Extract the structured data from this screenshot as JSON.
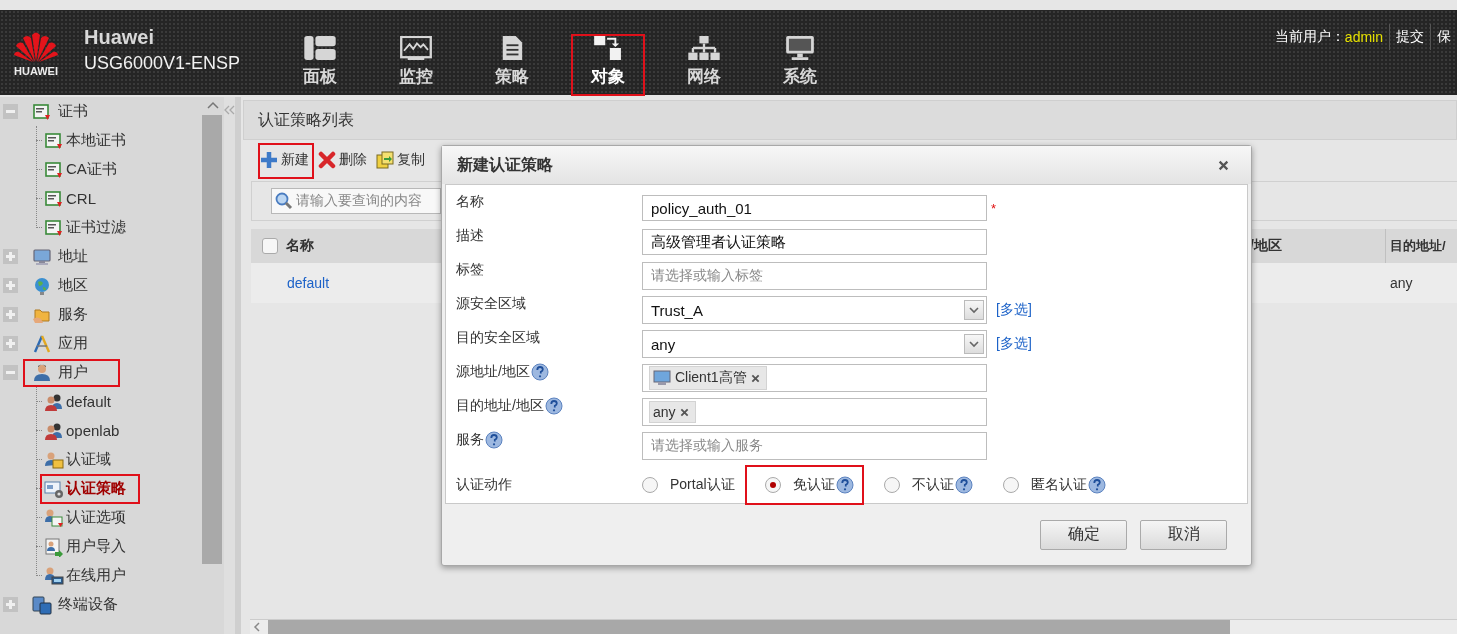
{
  "header": {
    "logo_text": "HUAWEI",
    "title": "Huawei",
    "model": "USG6000V1-ENSP",
    "nav": [
      {
        "label": "面板",
        "selected": false,
        "highlighted": false
      },
      {
        "label": "监控",
        "selected": false,
        "highlighted": false
      },
      {
        "label": "策略",
        "selected": false,
        "highlighted": false
      },
      {
        "label": "对象",
        "selected": true,
        "highlighted": true
      },
      {
        "label": "网络",
        "selected": false,
        "highlighted": false
      },
      {
        "label": "系统",
        "selected": false,
        "highlighted": false
      }
    ],
    "user_label": "当前用户：",
    "user": "admin",
    "actions": [
      {
        "label": "提交"
      },
      {
        "label": "保"
      }
    ]
  },
  "sidebar": {
    "tree": [
      {
        "label": "证书",
        "expanded": true,
        "selected": false,
        "highlighted": false,
        "children": [
          {
            "label": "本地证书",
            "selected": false,
            "highlighted": false
          },
          {
            "label": "CA证书",
            "selected": false,
            "highlighted": false
          },
          {
            "label": "CRL",
            "selected": false,
            "highlighted": false
          },
          {
            "label": "证书过滤",
            "selected": false,
            "highlighted": false
          }
        ]
      },
      {
        "label": "地址",
        "expanded": false,
        "selected": false,
        "highlighted": false
      },
      {
        "label": "地区",
        "expanded": false,
        "selected": false,
        "highlighted": false
      },
      {
        "label": "服务",
        "expanded": false,
        "selected": false,
        "highlighted": false
      },
      {
        "label": "应用",
        "expanded": false,
        "selected": false,
        "highlighted": false
      },
      {
        "label": "用户",
        "expanded": true,
        "selected": false,
        "highlighted": true,
        "children": [
          {
            "label": "default",
            "selected": false,
            "highlighted": false
          },
          {
            "label": "openlab",
            "selected": false,
            "highlighted": false
          },
          {
            "label": "认证域",
            "selected": false,
            "highlighted": false
          },
          {
            "label": "认证策略",
            "selected": true,
            "highlighted": true
          },
          {
            "label": "认证选项",
            "selected": false,
            "highlighted": false
          },
          {
            "label": "用户导入",
            "selected": false,
            "highlighted": false
          },
          {
            "label": "在线用户",
            "selected": false,
            "highlighted": false
          }
        ]
      },
      {
        "label": "终端设备",
        "expanded": false,
        "selected": false,
        "highlighted": false
      }
    ]
  },
  "content": {
    "title": "认证策略列表",
    "toolbar": [
      {
        "label": "新建",
        "kind": "add",
        "highlighted": true
      },
      {
        "label": "删除",
        "kind": "delete",
        "highlighted": false
      },
      {
        "label": "复制",
        "kind": "copy",
        "highlighted": false
      }
    ],
    "search": {
      "placeholder": "请输入要查询的内容"
    },
    "table": {
      "select_all_checked": false,
      "columns": [
        {
          "label": "名称"
        },
        {
          "label": "/地区"
        },
        {
          "label": "目的地址/"
        }
      ],
      "rows": [
        {
          "name": "default",
          "column_3": "any"
        }
      ]
    }
  },
  "dialog": {
    "title": "新建认证策略",
    "fields": [
      {
        "label": "名称",
        "help": false,
        "kind": "text",
        "value": "policy_auth_01",
        "required_mark": "*"
      },
      {
        "label": "描述",
        "help": false,
        "kind": "text",
        "value": "高级管理者认证策略"
      },
      {
        "label": "标签",
        "help": false,
        "kind": "text",
        "placeholder": "请选择或输入标签"
      },
      {
        "label": "源安全区域",
        "help": false,
        "kind": "select",
        "value": "Trust_A",
        "link": "[多选]"
      },
      {
        "label": "目的安全区域",
        "help": false,
        "kind": "select",
        "value": "any",
        "link": "[多选]"
      },
      {
        "label": "源地址/地区",
        "help": true,
        "kind": "tags",
        "tags": [
          {
            "label": "Client1高管",
            "kind": "host"
          }
        ]
      },
      {
        "label": "目的地址/地区",
        "help": true,
        "kind": "tags",
        "tags": [
          {
            "label": "any",
            "kind": "plain"
          }
        ]
      },
      {
        "label": "服务",
        "help": true,
        "kind": "text",
        "placeholder": "请选择或输入服务"
      }
    ],
    "action": {
      "label": "认证动作",
      "options": [
        {
          "label": "Portal认证",
          "selected": false,
          "help": false,
          "highlighted": false
        },
        {
          "label": "免认证",
          "selected": true,
          "help": true,
          "highlighted": true
        },
        {
          "label": "不认证",
          "selected": false,
          "help": true,
          "highlighted": false
        },
        {
          "label": "匿名认证",
          "selected": false,
          "help": true,
          "highlighted": false
        }
      ]
    },
    "buttons": [
      {
        "label": "确定"
      },
      {
        "label": "取消"
      }
    ]
  }
}
